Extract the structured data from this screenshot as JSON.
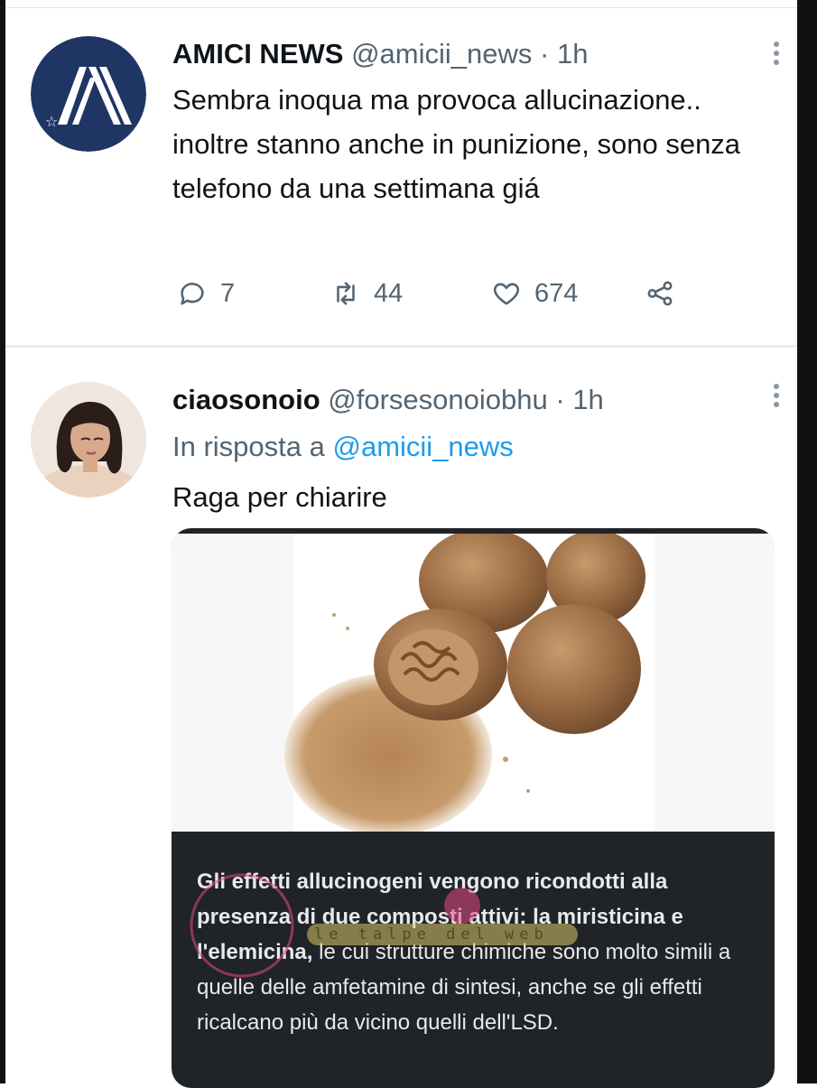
{
  "tweets": [
    {
      "name": "AMICI NEWS",
      "handle": "@amicii_news",
      "dot": "·",
      "time": "1h",
      "text": "Sembra inoqua ma provoca allucinazione.. inoltre stanno anche in punizione, sono senza telefono da una settimana giá",
      "actions": {
        "replies": "7",
        "retweets": "44",
        "likes": "674"
      },
      "icons": [
        "reply-icon",
        "retweet-icon",
        "like-icon",
        "share-icon",
        "more-icon"
      ]
    },
    {
      "name": "ciaosonoio",
      "handle": "@forsesonoiobhu",
      "dot": "·",
      "time": "1h",
      "reply_prefix": "In risposta a",
      "reply_to": "@amicii_news",
      "text": "Raga per chiarire",
      "card": {
        "bold_text": "Gli effetti allucinogeni vengono ricondotti alla presenza di due composti attivi: la miristicina e l'elemicina,",
        "text": " le cui strutture chimiche sono molto simili a quelle delle amfetamine di sintesi, anche se gli effetti ricalcano più da vicino quelli dell'LSD."
      }
    }
  ],
  "watermark": {
    "text": "le talpe del web"
  },
  "colors": {
    "accent": "#1d9bf0",
    "secondary_text": "#536471",
    "card_background": "#202327",
    "avatar_brand": "#1f3564"
  }
}
